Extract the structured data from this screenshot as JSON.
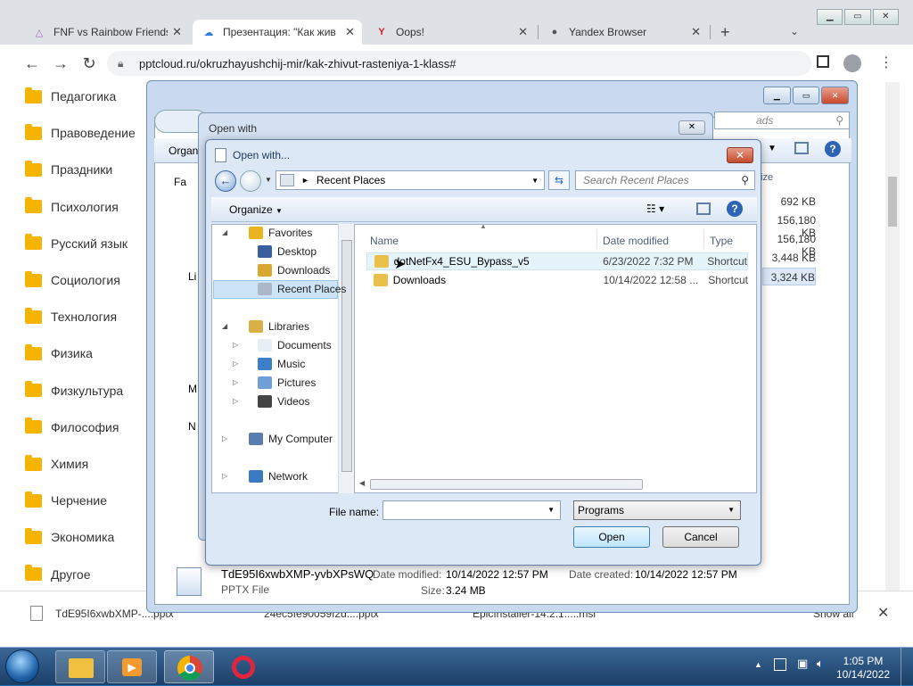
{
  "browser": {
    "tabs": [
      {
        "title": "FNF vs Rainbow Friends",
        "icon": "fnf-icon"
      },
      {
        "title": "Презентация: \"Как жив",
        "icon": "pptcloud-icon"
      },
      {
        "title": "Oops!",
        "icon": "yandex-y-icon"
      },
      {
        "title": "Yandex Browser",
        "icon": "yandex-globe-icon"
      }
    ],
    "url": "pptcloud.ru/okruzhayushchij-mir/kak-zhivut-rasteniya-1-klass#"
  },
  "sidebar": {
    "items": [
      "Педагогика",
      "Правоведение",
      "Праздники",
      "Психология",
      "Русский язык",
      "Социология",
      "Технология",
      "Физика",
      "Физкультура",
      "Философия",
      "Химия",
      "Черчение",
      "Экономика",
      "Другое"
    ]
  },
  "downloads": {
    "items": [
      "TdE95I6xwbXMP-....pptx",
      "24ec5fe90059f2d....pptx",
      "EpicInstaller-14.2.1.....msi"
    ],
    "show_all": "Show all"
  },
  "bg_window": {
    "search_placeholder": "ads",
    "organize": "Organ",
    "size_header": "ize",
    "sizes": [
      "692 KB",
      "156,180 KB",
      "156,180 KB",
      "3,448 KB",
      "3,324 KB"
    ],
    "left_labels": [
      "Fa",
      "Li",
      "M",
      "N"
    ]
  },
  "open_with_outer": {
    "title": "Open with"
  },
  "dialog": {
    "title": "Open with...",
    "location": "Recent Places",
    "search_placeholder": "Search Recent Places",
    "organize": "Organize",
    "tree": {
      "favorites": "Favorites",
      "desktop": "Desktop",
      "downloads": "Downloads",
      "recent_places": "Recent Places",
      "libraries": "Libraries",
      "documents": "Documents",
      "music": "Music",
      "pictures": "Pictures",
      "videos": "Videos",
      "my_computer": "My Computer",
      "network": "Network"
    },
    "columns": {
      "name": "Name",
      "date": "Date modified",
      "type": "Type"
    },
    "files": [
      {
        "name": "dotNetFx4_ESU_Bypass_v5",
        "date": "6/23/2022 7:32 PM",
        "type": "Shortcut"
      },
      {
        "name": "Downloads",
        "date": "10/14/2022 12:58 ...",
        "type": "Shortcut"
      }
    ],
    "filename_label": "File name:",
    "filename_value": "",
    "filter": "Programs",
    "open_button": "Open",
    "cancel_button": "Cancel"
  },
  "details": {
    "file_name": "TdE95I6xwbXMP-yvbXPsWQ",
    "date_modified_label": "Date modified:",
    "date_modified": "10/14/2022 12:57 PM",
    "date_created_label": "Date created:",
    "date_created": "10/14/2022 12:57 PM",
    "type": "PPTX File",
    "size_label": "Size:",
    "size": "3.24 MB"
  },
  "taskbar": {
    "time": "1:05 PM",
    "date": "10/14/2022"
  }
}
